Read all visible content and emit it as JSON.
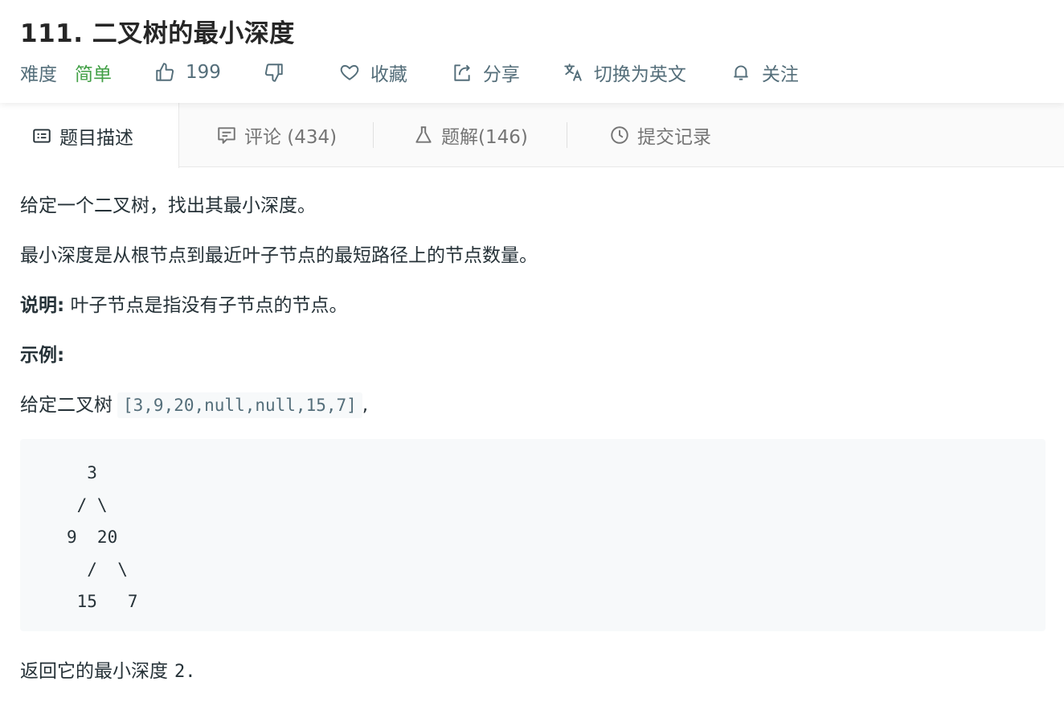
{
  "header": {
    "title": "111. 二叉树的最小深度",
    "difficulty_label": "难度",
    "difficulty_value": "简单",
    "like_count": "199",
    "favorite_label": "收藏",
    "share_label": "分享",
    "translate_label": "切换为英文",
    "follow_label": "关注"
  },
  "tabs": {
    "description": "题目描述",
    "comments": "评论 (434)",
    "solutions": "题解(146)",
    "submissions": "提交记录"
  },
  "content": {
    "p1": "给定一个二叉树，找出其最小深度。",
    "p2": "最小深度是从根节点到最近叶子节点的最短路径上的节点数量。",
    "p3_bold": "说明:",
    "p3_text": " 叶子节点是指没有子节点的节点。",
    "p4_bold": "示例:",
    "p5_text": "给定二叉树",
    "p5_code": "[3,9,20,null,null,15,7]",
    "p5_suffix": ",",
    "tree": "  3\n / \\\n9  20\n  /  \\\n 15   7",
    "p7_text": "返回它的最小深度",
    "p7_value": "2."
  },
  "colors": {
    "difficulty_easy": "#43a047",
    "text_secondary": "#546e7a",
    "code_bg": "#f7f9fa"
  }
}
